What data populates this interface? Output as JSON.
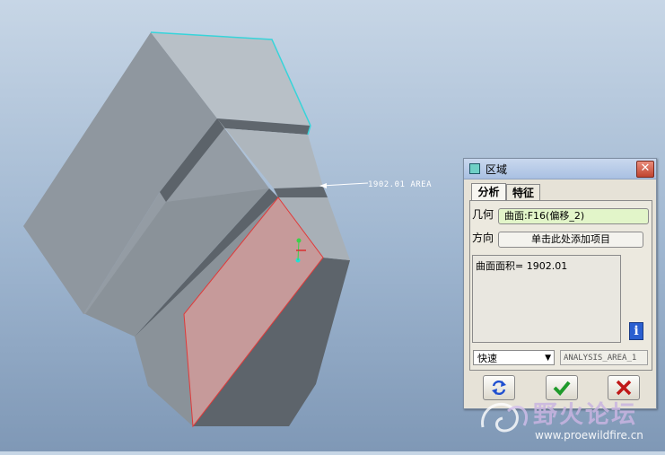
{
  "viewport": {
    "annotation_text": "1902.01 AREA",
    "colors": {
      "background": "#aec3da",
      "body_face": "#9ca3aa",
      "selected_face": "#c99a9a",
      "selected_edge": "#e23a3a",
      "highlight_edge": "#39d5da"
    }
  },
  "dialog": {
    "title": "区域",
    "close_label": "✕",
    "tabs": [
      {
        "label": "分析",
        "active": true
      },
      {
        "label": "特征",
        "active": false
      }
    ],
    "geometry_label": "几何",
    "geometry_value": "曲面:F16(偏移_2)",
    "direction_label": "方向",
    "direction_value": "单击此处添加项目",
    "result_text": "曲面面积= 1902.01",
    "info_icon": "i",
    "mode_selected": "快速",
    "analysis_name": "ANALYSIS_AREA_1",
    "buttons": {
      "repeat": "repeat-icon",
      "ok": "checkmark-icon",
      "cancel": "x-icon"
    }
  },
  "watermark": {
    "title": "野火论坛",
    "url": "www.proewildfire.cn"
  }
}
